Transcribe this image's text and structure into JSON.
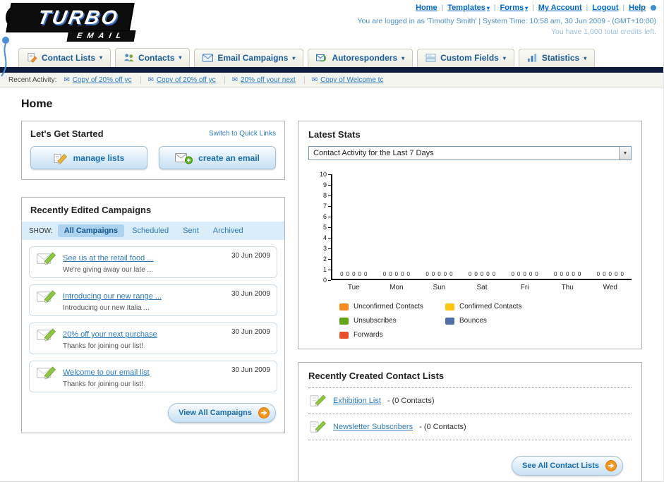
{
  "header": {
    "logo_line1": "TURBO",
    "logo_line2": "EMAIL",
    "top_links": [
      "Home",
      "Templates",
      "Forms",
      "My Account",
      "Logout",
      "Help"
    ],
    "login_info": "You are logged in as 'Timothy Smith' | System Time: 10:58 am, 30 Jun 2009 - (GMT+10:00)",
    "credits": "You have 1,000 total credits left."
  },
  "nav": {
    "tabs": [
      "Contact Lists",
      "Contacts",
      "Email Campaigns",
      "Autoresponders",
      "Custom Fields",
      "Statistics"
    ]
  },
  "recent_activity": {
    "label": "Recent Activity:",
    "items": [
      "Copy of 20% off yc",
      "Copy of 20% off yc",
      "20% off your next",
      "Copy of Welcome tc"
    ]
  },
  "page_title": "Home",
  "get_started": {
    "title": "Let's Get Started",
    "switch_link": "Switch to Quick Links",
    "buttons": [
      {
        "label": "manage lists"
      },
      {
        "label": "create an email"
      }
    ]
  },
  "campaigns": {
    "title": "Recently Edited Campaigns",
    "show_label": "SHOW:",
    "filters": [
      "All Campaigns",
      "Scheduled",
      "Sent",
      "Archived"
    ],
    "active_filter": "All Campaigns",
    "items": [
      {
        "title": "See us at the retail food ...",
        "subtitle": "We're giving away our late ...",
        "date": "30 Jun 2009"
      },
      {
        "title": "Introducing our new range ...",
        "subtitle": "Introducing our new Italia ...",
        "date": "30 Jun 2009"
      },
      {
        "title": "20% off your next purchase",
        "subtitle": "Thanks for joining our list!",
        "date": "30 Jun 2009"
      },
      {
        "title": "Welcome to our email list",
        "subtitle": "Thanks for joining our list!",
        "date": "30 Jun 2009"
      }
    ],
    "view_all": "View All Campaigns"
  },
  "stats": {
    "title": "Latest Stats",
    "period_selected": "Contact Activity for the Last 7 Days",
    "chart_data": {
      "type": "bar",
      "title": "Contact Activity for the Last 7 Days",
      "categories": [
        "Tue",
        "Mon",
        "Sun",
        "Sat",
        "Fri",
        "Thu",
        "Wed"
      ],
      "series": [
        {
          "name": "Unconfirmed Contacts",
          "color": "#f6891f",
          "values": [
            0,
            0,
            0,
            0,
            0,
            0,
            0
          ]
        },
        {
          "name": "Confirmed Contacts",
          "color": "#ffc40d",
          "values": [
            0,
            0,
            0,
            0,
            0,
            0,
            0
          ]
        },
        {
          "name": "Unsubscribes",
          "color": "#61a519",
          "values": [
            0,
            0,
            0,
            0,
            0,
            0,
            0
          ]
        },
        {
          "name": "Bounces",
          "color": "#4f6fa8",
          "values": [
            0,
            0,
            0,
            0,
            0,
            0,
            0
          ]
        },
        {
          "name": "Forwards",
          "color": "#e8502a",
          "values": [
            0,
            0,
            0,
            0,
            0,
            0,
            0
          ]
        }
      ],
      "ylim": [
        0,
        10
      ],
      "yticks": [
        0,
        1,
        2,
        3,
        4,
        5,
        6,
        7,
        8,
        9,
        10
      ],
      "grid": false,
      "legend_position": "bottom"
    }
  },
  "contact_lists": {
    "title": "Recently Created Contact Lists",
    "items": [
      {
        "name": "Exhibition List",
        "suffix": "- (0 Contacts)"
      },
      {
        "name": "Newsletter Subscribers",
        "suffix": "- (0 Contacts)"
      }
    ],
    "see_all": "See All Contact Lists"
  },
  "icons": {
    "envelope": "✉",
    "dropdown_arrow": "▾",
    "select_arrow": "▼"
  },
  "colors": {
    "link_blue": "#2e7bbf",
    "nav_blue": "#1a5d9e",
    "accent_orange": "#f6891f",
    "dark_bar": "#101c3d"
  }
}
